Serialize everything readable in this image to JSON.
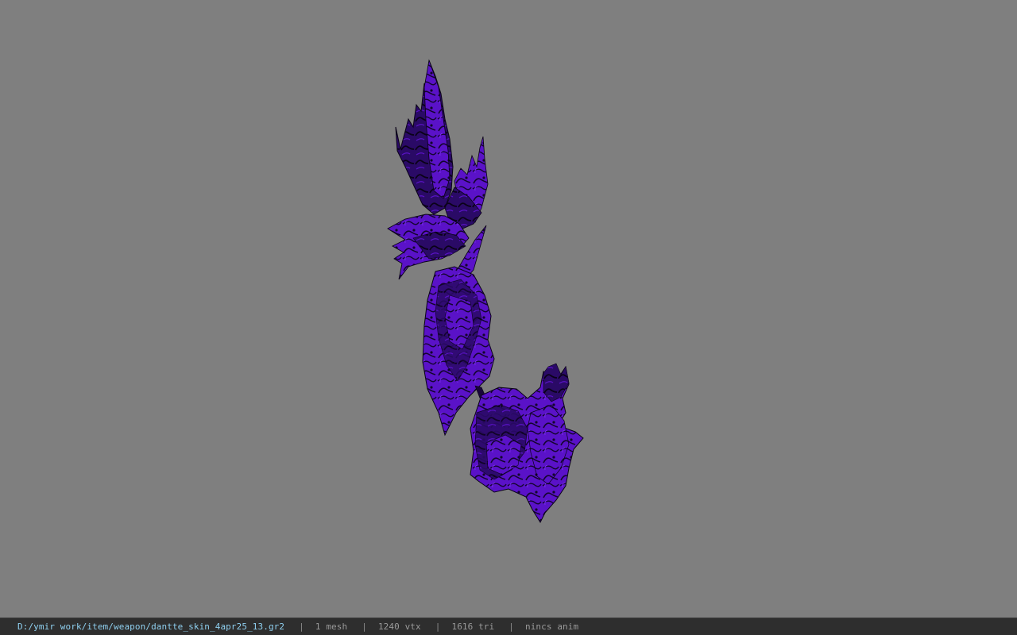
{
  "viewport": {
    "background_color": "#7f7f7f",
    "model": {
      "description_icon": "weapon-mesh",
      "primary_color": "#5a12c8",
      "shadow_color": "#120428",
      "highlight_color": "#7a2cf0"
    }
  },
  "statusbar": {
    "file_path": "D:/ymir work/item/weapon/dantte_skin_4apr25_13.gr2",
    "separator": "|",
    "mesh_count": "1 mesh",
    "vertex_count": "1240 vtx",
    "triangle_count": "1616 tri",
    "anim_status": "nincs anim",
    "path_color": "#8fd0f0",
    "text_color": "#9a9a9a"
  }
}
